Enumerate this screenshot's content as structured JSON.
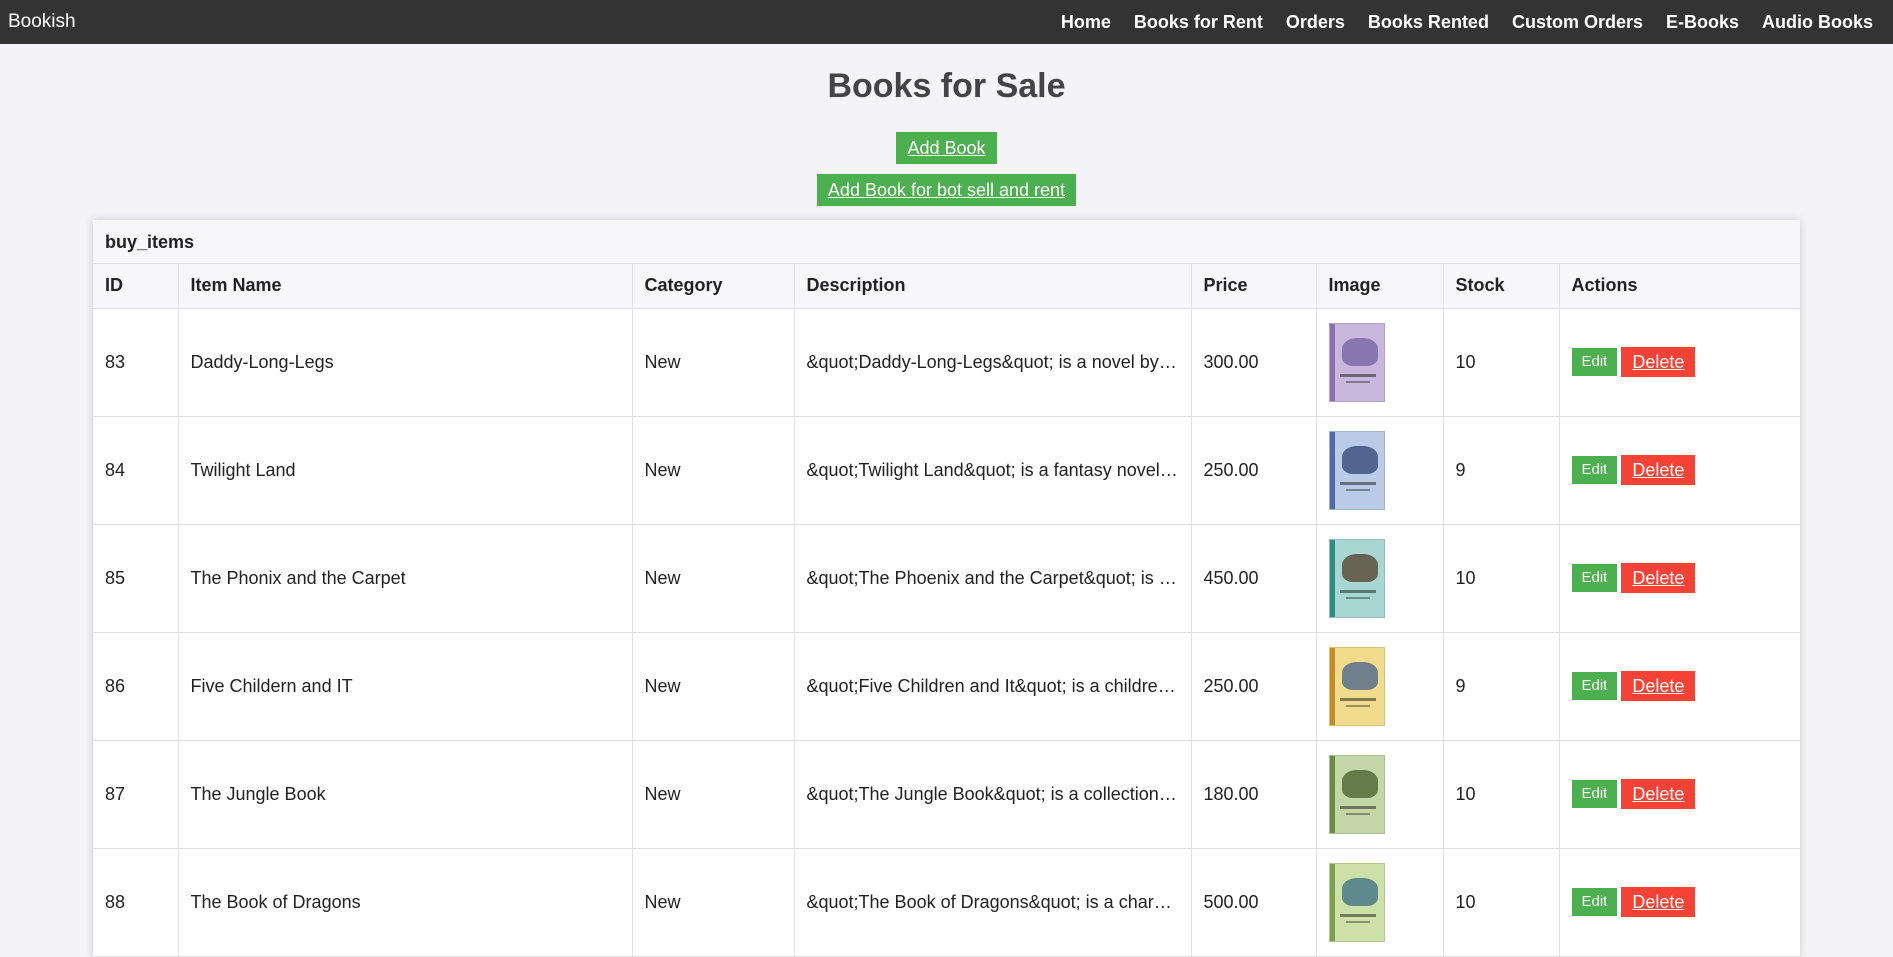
{
  "navbar": {
    "brand": "Bookish",
    "links": [
      "Home",
      "Books for Rent",
      "Orders",
      "Books Rented",
      "Custom Orders",
      "E-Books",
      "Audio Books"
    ]
  },
  "page": {
    "title": "Books for Sale",
    "add_book_label": "Add Book",
    "add_both_label": "Add Book for bot sell and rent"
  },
  "table": {
    "caption": "buy_items",
    "headers": [
      "ID",
      "Item Name",
      "Category",
      "Description",
      "Price",
      "Image",
      "Stock",
      "Actions"
    ],
    "edit_label": "Edit",
    "delete_label": "Delete",
    "rows": [
      {
        "id": "83",
        "name": "Daddy-Long-Legs",
        "category": "New",
        "description": "&quot;Daddy-Long-Legs&quot; is a novel by Jean Webster",
        "price": "300.00",
        "stock": "10",
        "cover_color": "#c9b8dc",
        "spine_color": "#8a70b0",
        "art_color": "#7d6aa8"
      },
      {
        "id": "84",
        "name": "Twilight Land",
        "category": "New",
        "description": "&quot;Twilight Land&quot; is a fantasy novel by Howard Pyle",
        "price": "250.00",
        "stock": "9",
        "cover_color": "#b9cbe6",
        "spine_color": "#4e6aa8",
        "art_color": "#3f5380"
      },
      {
        "id": "85",
        "name": "The Phonix and the Carpet",
        "category": "New",
        "description": "&quot;The Phoenix and the Carpet&quot; is a children's novel",
        "price": "450.00",
        "stock": "10",
        "cover_color": "#a8d6d2",
        "spine_color": "#2e8c82",
        "art_color": "#5c5040"
      },
      {
        "id": "86",
        "name": "Five Childern and IT",
        "category": "New",
        "description": "&quot;Five Children and It&quot; is a children's novel",
        "price": "250.00",
        "stock": "9",
        "cover_color": "#f1dc8e",
        "spine_color": "#c28a2a",
        "art_color": "#5b6f8c"
      },
      {
        "id": "87",
        "name": "The Jungle Book",
        "category": "New",
        "description": "&quot;The Jungle Book&quot; is a collection of stories",
        "price": "180.00",
        "stock": "10",
        "cover_color": "#c4d7a8",
        "spine_color": "#6a8c44",
        "art_color": "#556b3a"
      },
      {
        "id": "88",
        "name": "The Book of Dragons",
        "category": "New",
        "description": "&quot;The Book of Dragons&quot; is a charming collection",
        "price": "500.00",
        "stock": "10",
        "cover_color": "#cde0a8",
        "spine_color": "#7aa050",
        "art_color": "#4a7a88"
      }
    ]
  }
}
